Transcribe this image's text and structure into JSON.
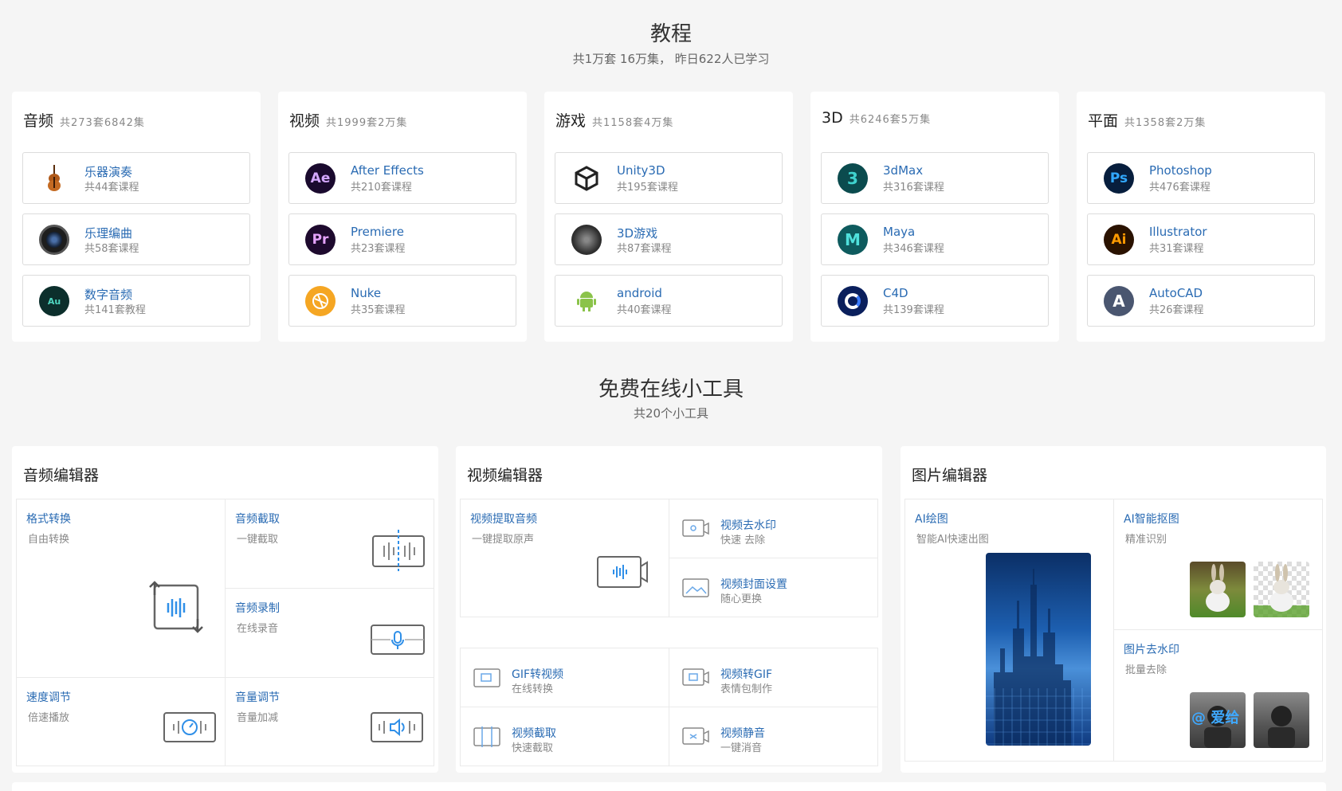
{
  "tutorials": {
    "title": "教程",
    "subtitle": "共1万套 16万集， 昨日622人已学习",
    "categories": [
      {
        "name": "音频",
        "count": "共273套6842集",
        "items": [
          {
            "name": "乐器演奏",
            "count": "共44套课程",
            "icon": "violin-icon"
          },
          {
            "name": "乐理编曲",
            "count": "共58套课程",
            "icon": "camera-lens-icon"
          },
          {
            "name": "数字音频",
            "count": "共141套教程",
            "icon": "audition-icon"
          }
        ]
      },
      {
        "name": "视频",
        "count": "共1999套2万集",
        "items": [
          {
            "name": "After Effects",
            "count": "共210套课程",
            "icon": "after-effects-icon",
            "badge": "Ae"
          },
          {
            "name": "Premiere",
            "count": "共23套课程",
            "icon": "premiere-icon",
            "badge": "Pr"
          },
          {
            "name": "Nuke",
            "count": "共35套课程",
            "icon": "nuke-icon"
          }
        ]
      },
      {
        "name": "游戏",
        "count": "共1158套4万集",
        "items": [
          {
            "name": "Unity3D",
            "count": "共195套课程",
            "icon": "unity-icon"
          },
          {
            "name": "3D游戏",
            "count": "共87套课程",
            "icon": "3d-game-icon"
          },
          {
            "name": "android",
            "count": "共40套课程",
            "icon": "android-icon"
          }
        ]
      },
      {
        "name": "3D",
        "count": "共6246套5万集",
        "items": [
          {
            "name": "3dMax",
            "count": "共316套课程",
            "icon": "3dmax-icon",
            "badge": "3"
          },
          {
            "name": "Maya",
            "count": "共346套课程",
            "icon": "maya-icon",
            "badge": "M"
          },
          {
            "name": "C4D",
            "count": "共139套课程",
            "icon": "c4d-icon"
          }
        ]
      },
      {
        "name": "平面",
        "count": "共1358套2万集",
        "items": [
          {
            "name": "Photoshop",
            "count": "共476套课程",
            "icon": "photoshop-icon",
            "badge": "Ps"
          },
          {
            "name": "Illustrator",
            "count": "共31套课程",
            "icon": "illustrator-icon",
            "badge": "Ai"
          },
          {
            "name": "AutoCAD",
            "count": "共26套课程",
            "icon": "autocad-icon",
            "badge": "A"
          }
        ]
      }
    ]
  },
  "tools": {
    "title": "免费在线小工具",
    "subtitle": "共20个小工具",
    "audio": {
      "title": "音频编辑器",
      "format": {
        "title": "格式转换",
        "desc": "自由转换"
      },
      "cut": {
        "title": "音频截取",
        "desc": "一键截取"
      },
      "record": {
        "title": "音频录制",
        "desc": "在线录音"
      },
      "speed": {
        "title": "速度调节",
        "desc": "倍速播放"
      },
      "volume": {
        "title": "音量调节",
        "desc": "音量加减"
      }
    },
    "video": {
      "title": "视频编辑器",
      "extract": {
        "title": "视频提取音频",
        "desc": "一键提取原声"
      },
      "watermark": {
        "title": "视频去水印",
        "desc": "快速 去除"
      },
      "cover": {
        "title": "视频封面设置",
        "desc": "随心更换"
      },
      "gif2video": {
        "title": "GIF转视频",
        "desc": "在线转换"
      },
      "video2gif": {
        "title": "视频转GIF",
        "desc": "表情包制作"
      },
      "cut": {
        "title": "视频截取",
        "desc": "快速截取"
      },
      "mute": {
        "title": "视频静音",
        "desc": "一键消音"
      }
    },
    "image": {
      "title": "图片编辑器",
      "ai_draw": {
        "title": "AI绘图",
        "desc": "智能AI快速出图"
      },
      "ai_matting": {
        "title": "AI智能抠图",
        "desc": "精准识别"
      },
      "watermark": {
        "title": "图片去水印",
        "desc": "批量去除"
      },
      "watermark_overlay": "@ 爱给"
    }
  },
  "colors": {
    "link": "#2a6bb3",
    "page_bg": "#f5f5f5"
  }
}
